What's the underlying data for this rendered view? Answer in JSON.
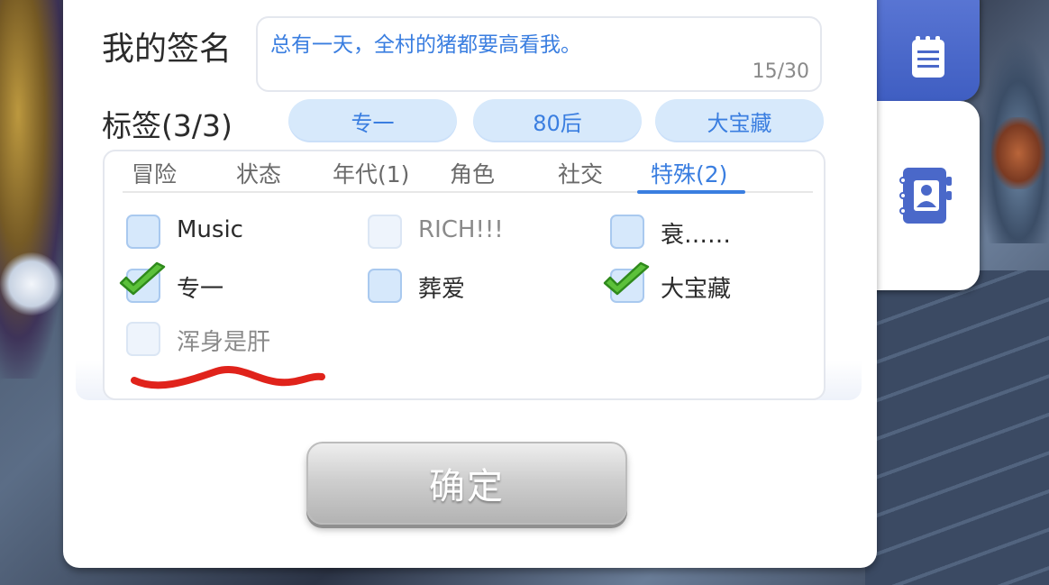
{
  "signature": {
    "label": "我的签名",
    "text": "总有一天，全村的猪都要高看我。",
    "count": "15/30"
  },
  "tags": {
    "label": "标签(3/3)",
    "selected": [
      "专一",
      "80后",
      "大宝藏"
    ]
  },
  "categories": {
    "tabs": [
      "冒险",
      "状态",
      "年代(1)",
      "角色",
      "社交",
      "特殊(2)"
    ],
    "active_tab": "特殊(2)"
  },
  "options": [
    {
      "label": "Music",
      "checked": false,
      "enabled": true
    },
    {
      "label": "RICH!!!",
      "checked": false,
      "enabled": false
    },
    {
      "label": "衰……",
      "checked": false,
      "enabled": true
    },
    {
      "label": "专一",
      "checked": true,
      "enabled": true
    },
    {
      "label": "葬爱",
      "checked": false,
      "enabled": true
    },
    {
      "label": "大宝藏",
      "checked": true,
      "enabled": true
    },
    {
      "label": "浑身是肝",
      "checked": false,
      "enabled": false
    }
  ],
  "confirm_label": "确定",
  "icons": {
    "side_tab_top": "notepad-icon",
    "side_tab_bottom": "contact-book-icon",
    "check": "check-mark-icon"
  },
  "colors": {
    "accent": "#3a7ee0",
    "pill_bg": "#d7e9fb",
    "side_tab_blue": "#4a68c9",
    "annotation": "#e0231b"
  }
}
